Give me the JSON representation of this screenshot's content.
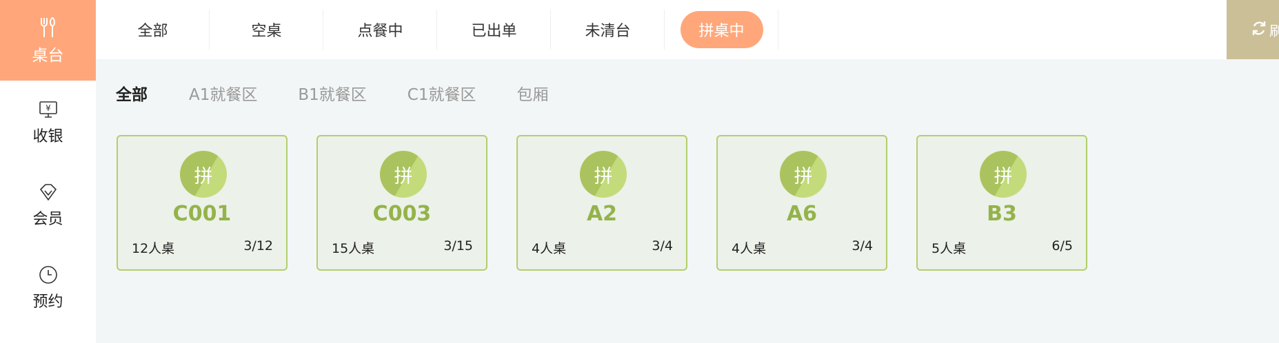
{
  "sidebar": {
    "items": [
      {
        "label": "桌台",
        "icon": "fork-knife-icon",
        "active": true
      },
      {
        "label": "收银",
        "icon": "cashier-monitor-icon",
        "active": false
      },
      {
        "label": "会员",
        "icon": "diamond-icon",
        "active": false
      },
      {
        "label": "预约",
        "icon": "clock-icon",
        "active": false
      }
    ]
  },
  "tabs": [
    {
      "label": "全部",
      "active": false
    },
    {
      "label": "空桌",
      "active": false
    },
    {
      "label": "点餐中",
      "active": false
    },
    {
      "label": "已出单",
      "active": false
    },
    {
      "label": "未清台",
      "active": false
    },
    {
      "label": "拼桌中",
      "active": true
    }
  ],
  "refresh": {
    "label": "刷",
    "icon": "refresh-icon",
    "color": "#cbbf98"
  },
  "areas": [
    {
      "label": "全部",
      "active": true
    },
    {
      "label": "A1就餐区",
      "active": false
    },
    {
      "label": "B1就餐区",
      "active": false
    },
    {
      "label": "C1就餐区",
      "active": false
    },
    {
      "label": "包厢",
      "active": false
    }
  ],
  "tables": [
    {
      "badge": "拼",
      "code": "C001",
      "capacity": "12人桌",
      "occupancy": "3/12"
    },
    {
      "badge": "拼",
      "code": "C003",
      "capacity": "15人桌",
      "occupancy": "3/15"
    },
    {
      "badge": "拼",
      "code": "A2",
      "capacity": "4人桌",
      "occupancy": "3/4"
    },
    {
      "badge": "拼",
      "code": "A6",
      "capacity": "4人桌",
      "occupancy": "3/4"
    },
    {
      "badge": "拼",
      "code": "B3",
      "capacity": "5人桌",
      "occupancy": "6/5"
    }
  ],
  "colors": {
    "accent": "#ffa77a",
    "table_green": "#94b34a",
    "card_border": "#b2cf6c",
    "card_bg": "#ecf1e9"
  }
}
